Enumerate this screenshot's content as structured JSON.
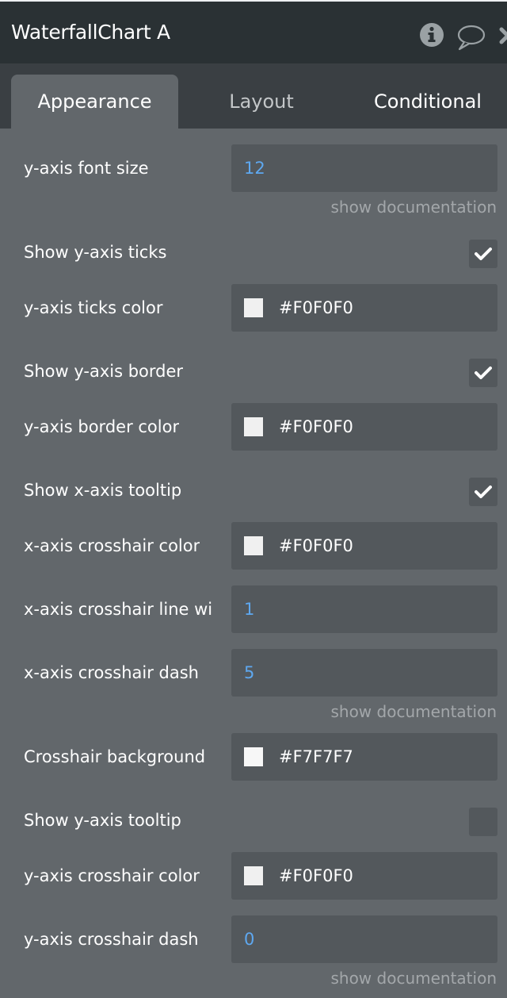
{
  "header": {
    "title": "WaterfallChart A",
    "icons": [
      "info-icon",
      "comment-icon",
      "close-icon"
    ]
  },
  "tabs": [
    {
      "label": "Appearance",
      "active": true
    },
    {
      "label": "Layout",
      "active": false
    },
    {
      "label": "Conditional",
      "active": false
    }
  ],
  "doc_link": "show documentation",
  "fields": {
    "y_axis_font_size": {
      "label": "y-axis font size",
      "value": "12"
    },
    "show_y_axis_ticks": {
      "label": "Show y-axis ticks",
      "checked": true
    },
    "y_axis_ticks_color": {
      "label": "y-axis ticks color",
      "value": "#F0F0F0",
      "swatch": "#F0F0F0"
    },
    "show_y_axis_border": {
      "label": "Show y-axis border",
      "checked": true
    },
    "y_axis_border_color": {
      "label": "y-axis border color",
      "value": "#F0F0F0",
      "swatch": "#F0F0F0"
    },
    "show_x_axis_tooltip": {
      "label": "Show x-axis tooltip",
      "checked": true
    },
    "x_axis_crosshair_color": {
      "label": "x-axis crosshair color",
      "value": "#F0F0F0",
      "swatch": "#F0F0F0"
    },
    "x_axis_crosshair_line_width": {
      "label": "x-axis crosshair line wi",
      "value": "1"
    },
    "x_axis_crosshair_dash": {
      "label": "x-axis crosshair dash",
      "value": "5"
    },
    "crosshair_background": {
      "label": "Crosshair background",
      "value": "#F7F7F7",
      "swatch": "#F7F7F7"
    },
    "show_y_axis_tooltip": {
      "label": "Show y-axis tooltip",
      "checked": false
    },
    "y_axis_crosshair_color": {
      "label": "y-axis crosshair color",
      "value": "#F0F0F0",
      "swatch": "#F0F0F0"
    },
    "y_axis_crosshair_dash": {
      "label": "y-axis crosshair dash",
      "value": "0"
    }
  }
}
